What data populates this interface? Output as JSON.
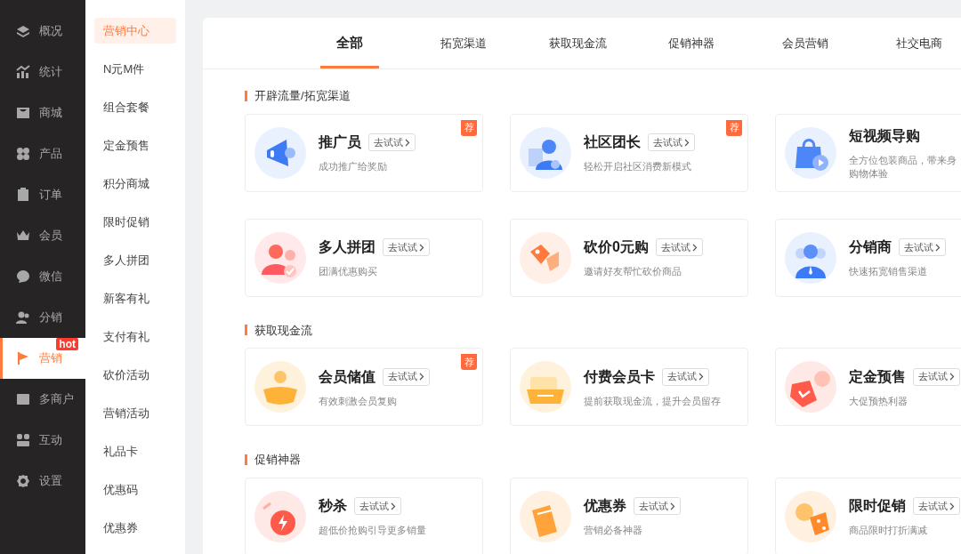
{
  "sidebar": {
    "items": [
      {
        "label": "概况",
        "selected": false
      },
      {
        "label": "统计",
        "selected": false
      },
      {
        "label": "商城",
        "selected": false
      },
      {
        "label": "产品",
        "selected": false
      },
      {
        "label": "订单",
        "selected": false
      },
      {
        "label": "会员",
        "selected": false
      },
      {
        "label": "微信",
        "selected": false
      },
      {
        "label": "分销",
        "selected": false
      },
      {
        "label": "营销",
        "selected": true,
        "badge": "hot"
      },
      {
        "label": "多商户",
        "selected": false
      },
      {
        "label": "互动",
        "selected": false
      },
      {
        "label": "设置",
        "selected": false
      }
    ]
  },
  "submenu": {
    "items": [
      {
        "label": "营销中心",
        "selected": true
      },
      {
        "label": "N元M件",
        "selected": false
      },
      {
        "label": "组合套餐",
        "selected": false
      },
      {
        "label": "定金预售",
        "selected": false
      },
      {
        "label": "积分商城",
        "selected": false
      },
      {
        "label": "限时促销",
        "selected": false
      },
      {
        "label": "多人拼团",
        "selected": false
      },
      {
        "label": "新客有礼",
        "selected": false
      },
      {
        "label": "支付有礼",
        "selected": false
      },
      {
        "label": "砍价活动",
        "selected": false
      },
      {
        "label": "营销活动",
        "selected": false
      },
      {
        "label": "礼品卡",
        "selected": false
      },
      {
        "label": "优惠码",
        "selected": false
      },
      {
        "label": "优惠券",
        "selected": false
      }
    ]
  },
  "tabs": [
    {
      "label": "全部",
      "selected": true
    },
    {
      "label": "拓宽渠道",
      "selected": false
    },
    {
      "label": "获取现金流",
      "selected": false
    },
    {
      "label": "促销神器",
      "selected": false
    },
    {
      "label": "会员营销",
      "selected": false
    },
    {
      "label": "社交电商",
      "selected": false
    }
  ],
  "sections": [
    {
      "title": "开辟流量/拓宽渠道",
      "cards": [
        {
          "title": "推广员",
          "button": "去试试",
          "desc": [
            "成功推广给奖励"
          ],
          "badge": "荐"
        },
        {
          "title": "社区团长",
          "button": "去试试",
          "desc": [
            "轻松开启社区消费新模式"
          ],
          "badge": "荐"
        },
        {
          "title": "短视频导购",
          "desc": [
            "全方位包装商品，带来身",
            "购物体验"
          ]
        },
        {
          "title": "多人拼团",
          "button": "去试试",
          "desc": [
            "团满优惠购买"
          ]
        },
        {
          "title": "砍价0元购",
          "button": "去试试",
          "desc": [
            "邀请好友帮忙砍价商品"
          ]
        },
        {
          "title": "分销商",
          "button": "去试试",
          "desc": [
            "快速拓宽销售渠道"
          ]
        }
      ]
    },
    {
      "title": "获取现金流",
      "cards": [
        {
          "title": "会员储值",
          "button": "去试试",
          "desc": [
            "有效刺激会员复购"
          ],
          "badge": "荐"
        },
        {
          "title": "付费会员卡",
          "button": "去试试",
          "desc": [
            "提前获取现金流，提升会员留存"
          ]
        },
        {
          "title": "定金预售",
          "button": "去试试",
          "desc": [
            "大促预热利器"
          ]
        }
      ]
    },
    {
      "title": "促销神器",
      "cards": [
        {
          "title": "秒杀",
          "button": "去试试",
          "desc": [
            "超低价抢购引导更多销量"
          ]
        },
        {
          "title": "优惠券",
          "button": "去试试",
          "desc": [
            "营销必备神器"
          ]
        },
        {
          "title": "限时促销",
          "button": "去试试",
          "desc": [
            "商品限时打折满减"
          ]
        }
      ]
    }
  ]
}
